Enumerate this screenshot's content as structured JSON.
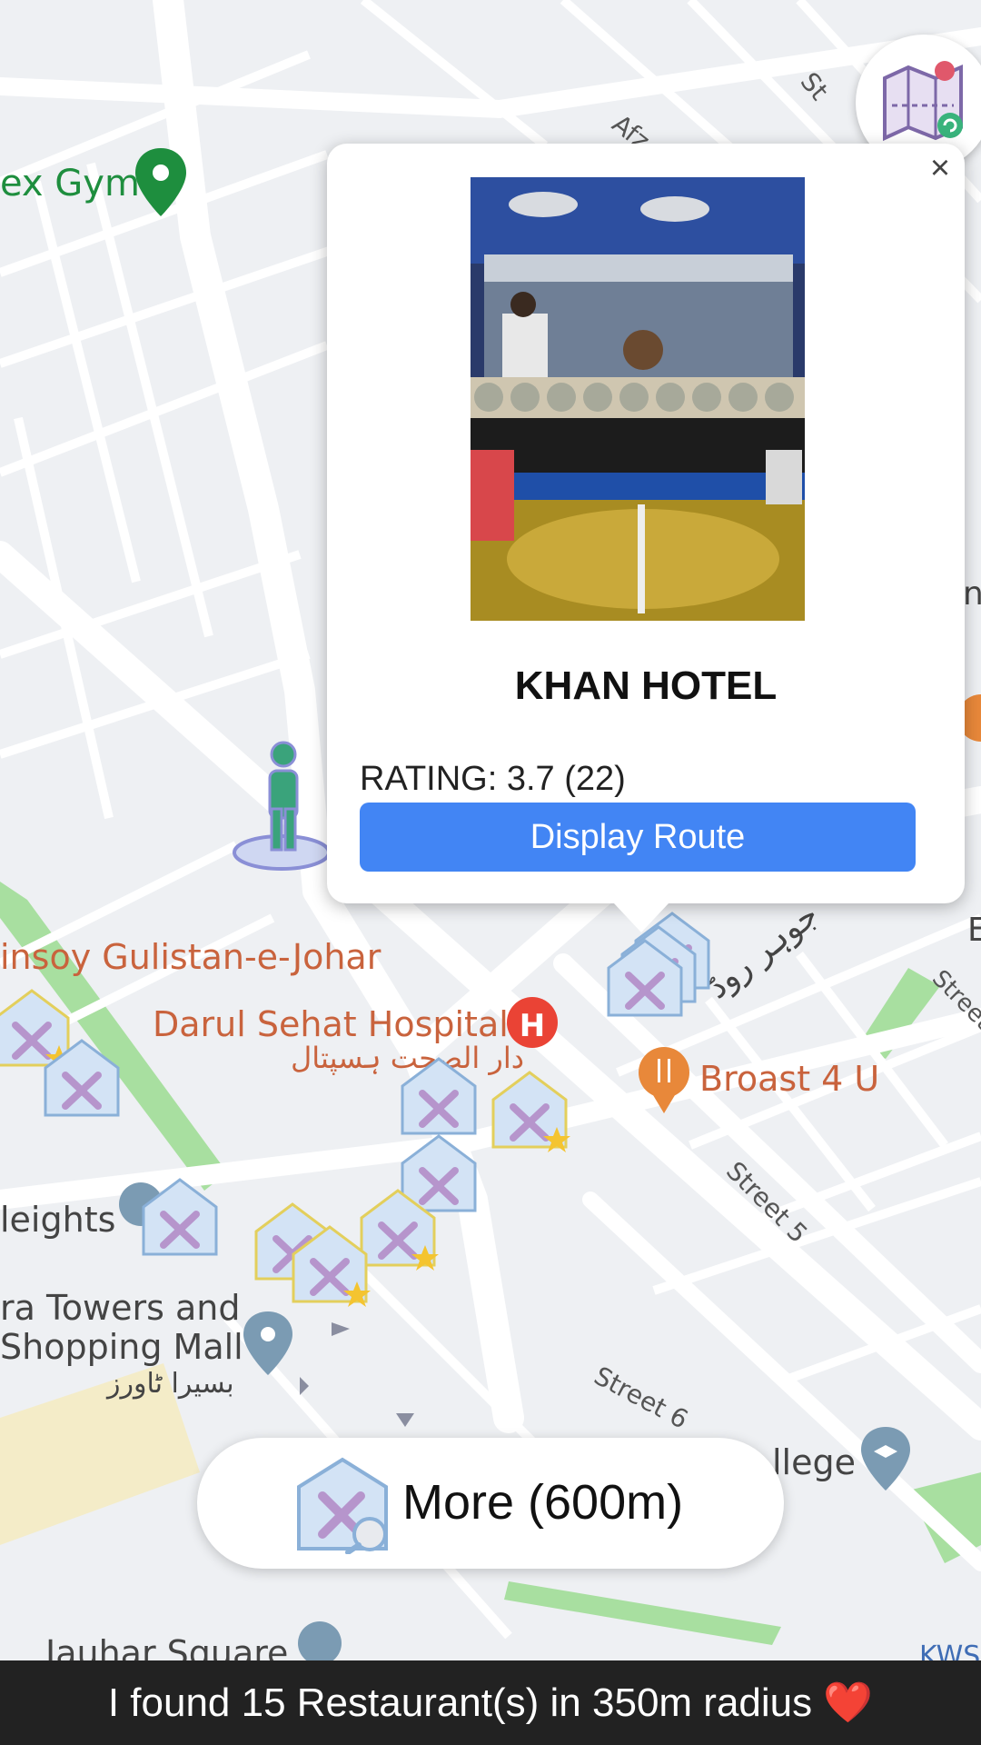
{
  "map": {
    "labels": {
      "gym": "ex Gym",
      "insoy": "insoy Gulistan-e-Johar",
      "hospital": "Darul Sehat Hospital",
      "hospital_urdu": "دار الصحت ہسپتال",
      "broast": "Broast 4 U",
      "johar_road_urdu": "جوہر روڈ",
      "street_5": "Street 5",
      "street_6": "Street 6",
      "street": "Street",
      "heights": "leights",
      "towers_1": "ra Towers and",
      "towers_2": "Shopping Mall",
      "towers_urdu": "بسیرا ٹاورز",
      "college": "llege",
      "afz": "Afz",
      "st": "St",
      "jauhar_square": "Jauhar Square",
      "kws": "KWS",
      "edge_e": "E",
      "edge_n": "n"
    },
    "colors": {
      "land": "#eef0f3",
      "road": "#ffffff",
      "park": "#a8dfa0",
      "accent_orange": "#e8883a",
      "label_orange": "#c9633d",
      "label_green": "#1e8e3e",
      "label_gray": "#444444"
    }
  },
  "popup": {
    "close_glyph": "×",
    "title": "KHAN HOTEL",
    "rating": "RATING: 3.7 (22)",
    "route_label": "Display Route",
    "accent": "#4285f4"
  },
  "more_button": {
    "label": "More (600m)"
  },
  "footer": {
    "message": "I found 15 Restaurant(s) in 350m radius ❤️"
  },
  "icons": {
    "map_toggle": "map-refresh-icon",
    "restaurant_marker": "restaurant-marker-icon",
    "user": "user-location-icon"
  }
}
